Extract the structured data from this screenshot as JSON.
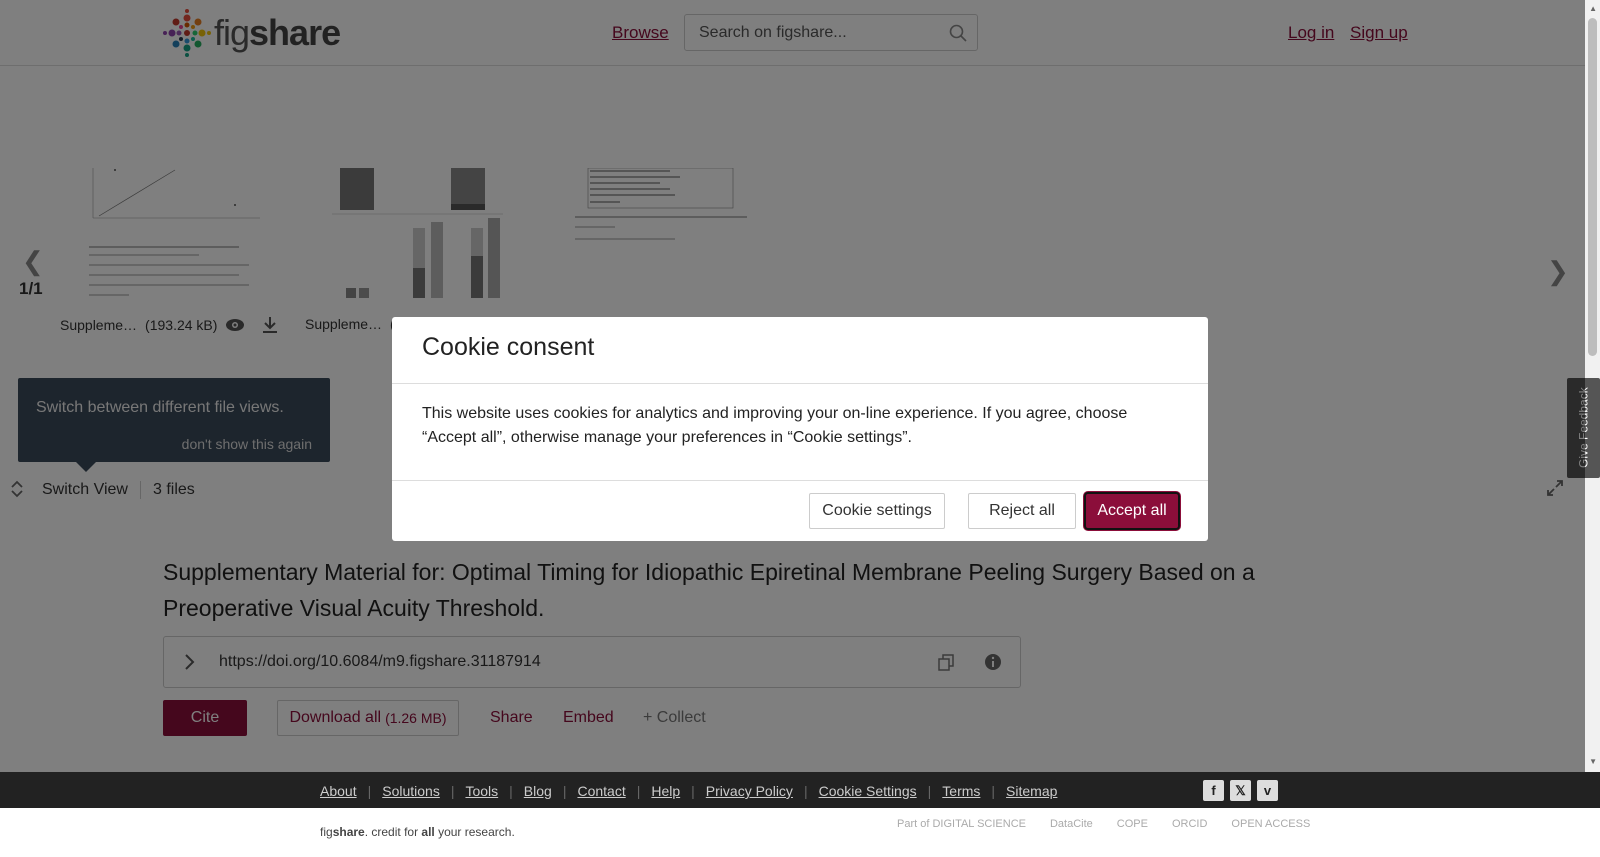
{
  "header": {
    "logo_text_light": "fig",
    "logo_text_bold": "share",
    "browse": "Browse",
    "search_placeholder": "Search on figshare...",
    "login": "Log in",
    "signup": "Sign up"
  },
  "viewer": {
    "page_count": "1/1",
    "files": [
      {
        "name": "Suppleme…",
        "size": "(193.24 kB)"
      },
      {
        "name": "Suppleme…",
        "size": "("
      }
    ],
    "tooltip_text": "Switch between different file views.",
    "tooltip_link": "don't show this again",
    "switch_view": "Switch View",
    "file_count": "3 files",
    "feedback": "Give Feedback"
  },
  "article": {
    "title": "Supplementary Material for: Optimal Timing for Idiopathic Epiretinal Membrane Peeling Surgery Based on a Preoperative Visual Acuity Threshold.",
    "doi": "https://doi.org/10.6084/m9.figshare.31187914",
    "cite": "Cite",
    "download_all": "Download all",
    "download_size": "(1.26 MB)",
    "share": "Share",
    "embed": "Embed",
    "collect": "+ Collect"
  },
  "footer": {
    "links": [
      "About",
      "Solutions",
      "Tools",
      "Blog",
      "Contact",
      "Help",
      "Privacy Policy",
      "Cookie Settings",
      "Terms",
      "Sitemap"
    ],
    "credit_light1": "fig",
    "credit_bold1": "share",
    "credit_mid": ". credit for ",
    "credit_bold2": "all",
    "credit_end": " your research.",
    "partners": [
      "Part of DIGITAL SCIENCE",
      "DataCite",
      "COPE",
      "ORCID",
      "OPEN ACCESS"
    ]
  },
  "modal": {
    "title": "Cookie consent",
    "body": "This website uses cookies for analytics and improving your on-line experience. If you agree, choose “Accept all”, otherwise manage your preferences in “Cookie settings”.",
    "settings": "Cookie settings",
    "reject": "Reject all",
    "accept": "Accept all"
  },
  "colors": {
    "brand": "#8b0e3a",
    "footer_bg": "#222222",
    "tooltip_bg": "#3b4a5a"
  }
}
